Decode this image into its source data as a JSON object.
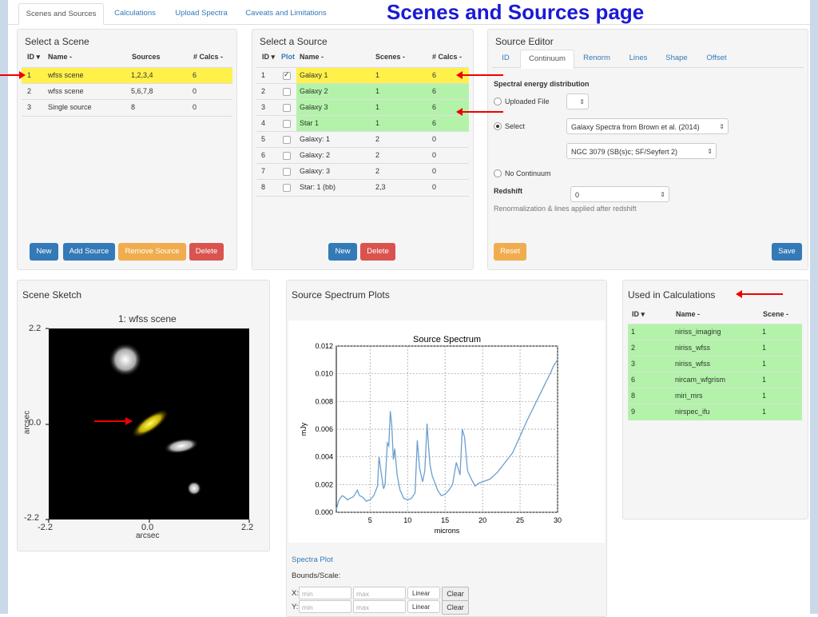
{
  "banner": "Scenes and Sources page",
  "tabs": [
    "Scenes and Sources",
    "Calculations",
    "Upload Spectra",
    "Caveats and Limitations"
  ],
  "scenes": {
    "title": "Select a Scene",
    "headers": [
      "ID ▾",
      "Name -",
      "Sources",
      "# Calcs -"
    ],
    "rows": [
      [
        "1",
        "wfss scene",
        "1,2,3,4",
        "6"
      ],
      [
        "2",
        "wfss scene",
        "5,6,7,8",
        "0"
      ],
      [
        "3",
        "Single source",
        "8",
        "0"
      ]
    ],
    "buttons": [
      "New",
      "Add Source",
      "Remove Source",
      "Delete"
    ]
  },
  "sources": {
    "title": "Select a Source",
    "headers": [
      "ID ▾",
      "Plot",
      "Name -",
      "Scenes -",
      "# Calcs -"
    ],
    "rows": [
      [
        "1",
        "Galaxy 1",
        "1",
        "6"
      ],
      [
        "2",
        "Galaxy 2",
        "1",
        "6"
      ],
      [
        "3",
        "Galaxy 3",
        "1",
        "6"
      ],
      [
        "4",
        "Star 1",
        "1",
        "6"
      ],
      [
        "5",
        "Galaxy: 1",
        "2",
        "0"
      ],
      [
        "6",
        "Galaxy: 2",
        "2",
        "0"
      ],
      [
        "7",
        "Galaxy: 3",
        "2",
        "0"
      ],
      [
        "8",
        "Star: 1 (bb)",
        "2,3",
        "0"
      ]
    ],
    "buttons": [
      "New",
      "Delete"
    ]
  },
  "editor": {
    "title": "Source Editor",
    "tabs": [
      "ID",
      "Continuum",
      "Renorm",
      "Lines",
      "Shape",
      "Offset"
    ],
    "sed_label": "Spectral energy distribution",
    "opt_uploaded": "Uploaded File",
    "opt_select": "Select",
    "select1": "Galaxy Spectra from Brown et al. (2014)",
    "select2": "NGC 3079 (SB(s)c; SF/Seyfert 2)",
    "opt_none": "No Continuum",
    "redshift_label": "Redshift",
    "redshift_value": "0",
    "note": "Renormalization & lines applied after redshift",
    "reset": "Reset",
    "save": "Save"
  },
  "sketch": {
    "title": "Scene Sketch",
    "plot_title": "1: wfss scene",
    "ylabel": "arcsec",
    "xlabel": "arcsec",
    "yticks": [
      "2.2",
      "0.0",
      "-2.2"
    ],
    "xticks": [
      "-2.2",
      "0.0",
      "2.2"
    ]
  },
  "spectrum": {
    "title": "Source Spectrum Plots",
    "link": "Spectra Plot",
    "bounds_label": "Bounds/Scale:",
    "x_label": "X:",
    "y_label": "Y:",
    "min_placeholder": "min",
    "max_placeholder": "max",
    "scale": "Linear",
    "clear": "Clear"
  },
  "used": {
    "title": "Used in Calculations",
    "headers": [
      "ID ▾",
      "Name -",
      "Scene -"
    ],
    "rows": [
      [
        "1",
        "niriss_imaging",
        "1"
      ],
      [
        "2",
        "niriss_wfss",
        "1"
      ],
      [
        "3",
        "niriss_wfss",
        "1"
      ],
      [
        "6",
        "nircam_wfgrism",
        "1"
      ],
      [
        "8",
        "miri_mrs",
        "1"
      ],
      [
        "9",
        "nirspec_ifu",
        "1"
      ]
    ]
  },
  "colors": {
    "accent": "#337ab7",
    "highlight_yellow": "#fff14a",
    "highlight_green": "#b2f3a9",
    "arrow_red": "#e00000",
    "banner_blue": "#1a1ad6"
  },
  "chart_data": {
    "type": "line",
    "title": "Source Spectrum",
    "xlabel": "microns",
    "ylabel": "mJy",
    "xlim": [
      0.5,
      30
    ],
    "ylim": [
      0,
      0.012
    ],
    "xticks": [
      5,
      10,
      15,
      20,
      25,
      30
    ],
    "yticks": [
      0.0,
      0.002,
      0.004,
      0.006,
      0.008,
      0.01,
      0.012
    ],
    "grid": true,
    "series": [
      {
        "x": [
          0.5,
          0.8,
          1.0,
          1.3,
          1.6,
          2.0,
          2.3,
          2.7,
          3.0,
          3.3,
          3.6,
          4.0,
          4.5,
          5.0,
          5.5,
          6.0,
          6.2,
          6.5,
          6.8,
          7.0,
          7.3,
          7.5,
          7.7,
          7.9,
          8.1,
          8.3,
          8.6,
          9.0,
          9.5,
          10.0,
          10.5,
          11.0,
          11.3,
          11.6,
          12.0,
          12.3,
          12.6,
          12.8,
          13.0,
          13.3,
          13.6,
          14.0,
          14.5,
          15.0,
          15.5,
          16.0,
          16.5,
          17.0,
          17.3,
          17.6,
          18.0,
          18.5,
          19.0,
          19.5,
          20.0,
          21,
          22,
          23,
          24,
          25,
          26,
          27,
          28,
          29,
          29.5,
          30
        ],
        "y": [
          0.0002,
          0.0008,
          0.001,
          0.0012,
          0.0011,
          0.0009,
          0.001,
          0.0011,
          0.0013,
          0.0016,
          0.0012,
          0.0011,
          0.0008,
          0.0009,
          0.0012,
          0.0019,
          0.004,
          0.0028,
          0.0017,
          0.002,
          0.005,
          0.0048,
          0.0073,
          0.0062,
          0.0038,
          0.0046,
          0.0027,
          0.0016,
          0.001,
          0.0009,
          0.001,
          0.0014,
          0.0052,
          0.0032,
          0.0022,
          0.003,
          0.0064,
          0.0047,
          0.0034,
          0.0026,
          0.0022,
          0.0016,
          0.0012,
          0.0013,
          0.0016,
          0.002,
          0.0036,
          0.0027,
          0.006,
          0.0054,
          0.003,
          0.0024,
          0.0019,
          0.0021,
          0.0022,
          0.0024,
          0.0029,
          0.0036,
          0.0043,
          0.0055,
          0.0067,
          0.0078,
          0.0089,
          0.01,
          0.0106,
          0.011
        ]
      }
    ]
  }
}
